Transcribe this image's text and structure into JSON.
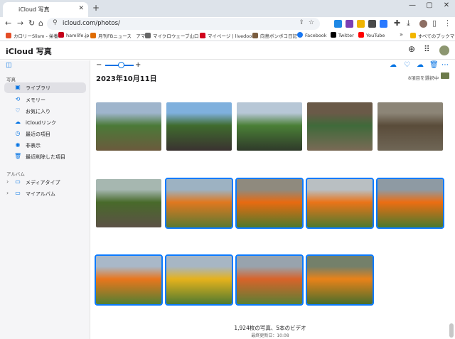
{
  "browser": {
    "tab_title": "iCloud 写真",
    "url": "icloud.com/photos/",
    "new_tab": "+",
    "minimize": "—",
    "maximize": "▢",
    "close": "✕"
  },
  "bookmarks": [
    {
      "label": "カロリーSlism - 栄養...",
      "color": "#e44d26"
    },
    {
      "label": "hamlife.jp",
      "color": "#c4001a"
    },
    {
      "label": "月刊FBニュース　アマ...",
      "color": "#e06c00"
    },
    {
      "label": "マイクロウェーブ山口 -...",
      "color": "#666666"
    },
    {
      "label": "マイページ | livedoor...",
      "color": "#d0021b"
    },
    {
      "label": "向島ボンボコ日記",
      "color": "#7a5c3e"
    },
    {
      "label": "Facebook",
      "color": "#1877f2"
    },
    {
      "label": "Twitter",
      "color": "#000000"
    },
    {
      "label": "YouTube",
      "color": "#ff0000"
    },
    {
      "label": "すべてのブックマーク",
      "color": "#f2b600"
    }
  ],
  "bookmarks_more": "»",
  "app": {
    "logo": "iCloud 写真"
  },
  "sidebar": {
    "photos_section": "写真",
    "items": [
      {
        "label": "ライブラリ",
        "icon": "library-icon",
        "glyph": "▣"
      },
      {
        "label": "メモリー",
        "icon": "memories-icon",
        "glyph": "⟲"
      },
      {
        "label": "お気に入り",
        "icon": "heart-icon",
        "glyph": "♡"
      },
      {
        "label": "iCloudリンク",
        "icon": "cloud-link-icon",
        "glyph": "☁"
      },
      {
        "label": "最近の項目",
        "icon": "recent-icon",
        "glyph": "◷"
      },
      {
        "label": "非表示",
        "icon": "eye-icon",
        "glyph": "◉"
      },
      {
        "label": "最近削除した項目",
        "icon": "trash-icon",
        "glyph": "🗑"
      }
    ],
    "albums_section": "アルバム",
    "albums": [
      {
        "label": "メディアタイプ",
        "icon": "media-types-icon",
        "glyph": "▭"
      },
      {
        "label": "マイアルバム",
        "icon": "my-albums-icon",
        "glyph": "▭"
      }
    ]
  },
  "main": {
    "date_heading": "2023年10月11日",
    "selection_label": "8項目を選択中",
    "zoom_minus": "−",
    "zoom_plus": "+",
    "zoom_level": 0.55,
    "summary": "1,924枚の写真、5本のビデオ",
    "updated": "最終更新日：10:08"
  },
  "photos": [
    {
      "name": "photo-1",
      "selected": false,
      "colors": [
        "#9fb5cc",
        "#4b7a38",
        "#6b5a3d"
      ]
    },
    {
      "name": "photo-2",
      "selected": false,
      "colors": [
        "#7fb0dd",
        "#3f6b2e",
        "#3a3230"
      ]
    },
    {
      "name": "photo-3",
      "selected": false,
      "colors": [
        "#b7c7d6",
        "#4a7f36",
        "#2f3a2a"
      ]
    },
    {
      "name": "photo-4",
      "selected": false,
      "colors": [
        "#6a5a48",
        "#3f6a3a",
        "#7a6a56"
      ]
    },
    {
      "name": "photo-5",
      "selected": false,
      "colors": [
        "#8c8577",
        "#5a4c3a",
        "#6f6656"
      ]
    },
    {
      "name": "photo-6",
      "selected": false,
      "colors": [
        "#a6b7b0",
        "#486a2a",
        "#5c5146"
      ]
    },
    {
      "name": "photo-7",
      "selected": true,
      "colors": [
        "#9db2c2",
        "#e0781f",
        "#5b7a33"
      ]
    },
    {
      "name": "photo-8",
      "selected": true,
      "colors": [
        "#8f8a7e",
        "#e86a10",
        "#4f7a2c"
      ]
    },
    {
      "name": "photo-9",
      "selected": true,
      "colors": [
        "#b9bfc2",
        "#eb7418",
        "#4d7a30"
      ]
    },
    {
      "name": "photo-10",
      "selected": true,
      "colors": [
        "#8e9aa3",
        "#ec6d12",
        "#4a7a2e"
      ]
    },
    {
      "name": "photo-11",
      "selected": true,
      "colors": [
        "#a9b8c8",
        "#e9761d",
        "#537f32"
      ]
    },
    {
      "name": "photo-12",
      "selected": true,
      "colors": [
        "#a7b6c4",
        "#e6b21c",
        "#4f7a30"
      ]
    },
    {
      "name": "photo-13",
      "selected": true,
      "colors": [
        "#98a3ad",
        "#d8632a",
        "#5a7f34"
      ]
    },
    {
      "name": "photo-14",
      "selected": true,
      "colors": [
        "#74806a",
        "#e98219",
        "#4a6e2c"
      ]
    }
  ]
}
